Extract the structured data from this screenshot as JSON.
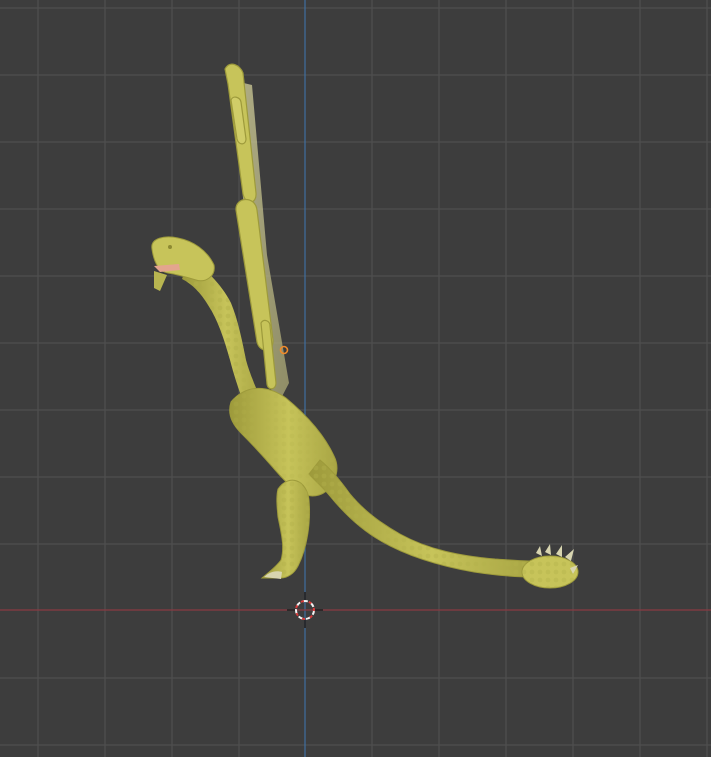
{
  "viewport": {
    "background": "#3d3d3d",
    "grid_color": "#4f4f4f",
    "x_axis_color": "#8a3b42",
    "z_axis_color": "#3f6f9f",
    "model_color": "#c7c45a",
    "model_shadow_color": "#9d9a3b",
    "claw_color": "#d8d5b0",
    "tongue_color": "#e3a58e",
    "icons": {
      "cursor": "3d-cursor-icon",
      "origin": "object-origin-icon"
    }
  }
}
